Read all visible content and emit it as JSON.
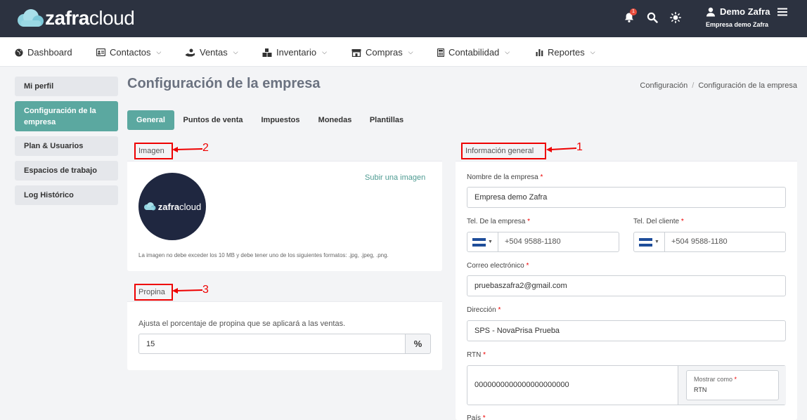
{
  "brand": {
    "name_bold": "zafra",
    "name_light": "cloud"
  },
  "header": {
    "notification_count": "1",
    "user_name": "Demo Zafra",
    "company_name": "Empresa demo Zafra"
  },
  "nav": {
    "items": [
      {
        "label": "Dashboard",
        "icon": "globe-icon"
      },
      {
        "label": "Contactos",
        "icon": "contact-card-icon"
      },
      {
        "label": "Ventas",
        "icon": "hand-coin-icon"
      },
      {
        "label": "Inventario",
        "icon": "boxes-icon"
      },
      {
        "label": "Compras",
        "icon": "store-icon"
      },
      {
        "label": "Contabilidad",
        "icon": "calculator-icon"
      },
      {
        "label": "Reportes",
        "icon": "bar-chart-icon"
      }
    ]
  },
  "sidebar": {
    "items": [
      {
        "label": "Mi perfil"
      },
      {
        "label": "Configuración de la empresa",
        "active": true
      },
      {
        "label": "Plan & Usuarios"
      },
      {
        "label": "Espacios de trabajo"
      },
      {
        "label": "Log Histórico"
      }
    ]
  },
  "page": {
    "title": "Configuración de la empresa",
    "breadcrumb": [
      "Configuración",
      "Configuración de la empresa"
    ],
    "breadcrumb_separator": "/"
  },
  "tabs": [
    {
      "label": "General",
      "active": true
    },
    {
      "label": "Puntos de venta"
    },
    {
      "label": "Impuestos"
    },
    {
      "label": "Monedas"
    },
    {
      "label": "Plantillas"
    }
  ],
  "image_card": {
    "title": "Imagen",
    "annotation": "2",
    "upload_link": "Subir una imagen",
    "note": "La imagen no debe exceder los 10 MB y debe tener uno de los siguientes formatos: .jpg, .jpeg, .png."
  },
  "tip_card": {
    "title": "Propina",
    "annotation": "3",
    "description": "Ajusta el porcentaje de propina que se aplicará a las ventas.",
    "value": "15",
    "suffix": "%"
  },
  "general_info": {
    "title": "Información general",
    "annotation": "1",
    "company_name_label": "Nombre de la empresa",
    "company_name_value": "Empresa demo Zafra",
    "company_phone_label": "Tel. De la empresa",
    "company_phone_value": "+504 9588-1180",
    "client_phone_label": "Tel. Del cliente",
    "client_phone_value": "+504 9588-1180",
    "email_label": "Correo electrónico",
    "email_value": "pruebaszafra2@gmail.com",
    "address_label": "Dirección",
    "address_value": "SPS - NovaPrisa Prueba",
    "rtn_label": "RTN",
    "rtn_value": "0000000000000000000000",
    "display_as_label": "Mostrar como",
    "display_as_value": "RTN",
    "country_label": "País",
    "required_mark": "*"
  },
  "colors": {
    "topbar": "#2c3240",
    "accent": "#5ba8a0",
    "annotation": "#ee0000"
  }
}
